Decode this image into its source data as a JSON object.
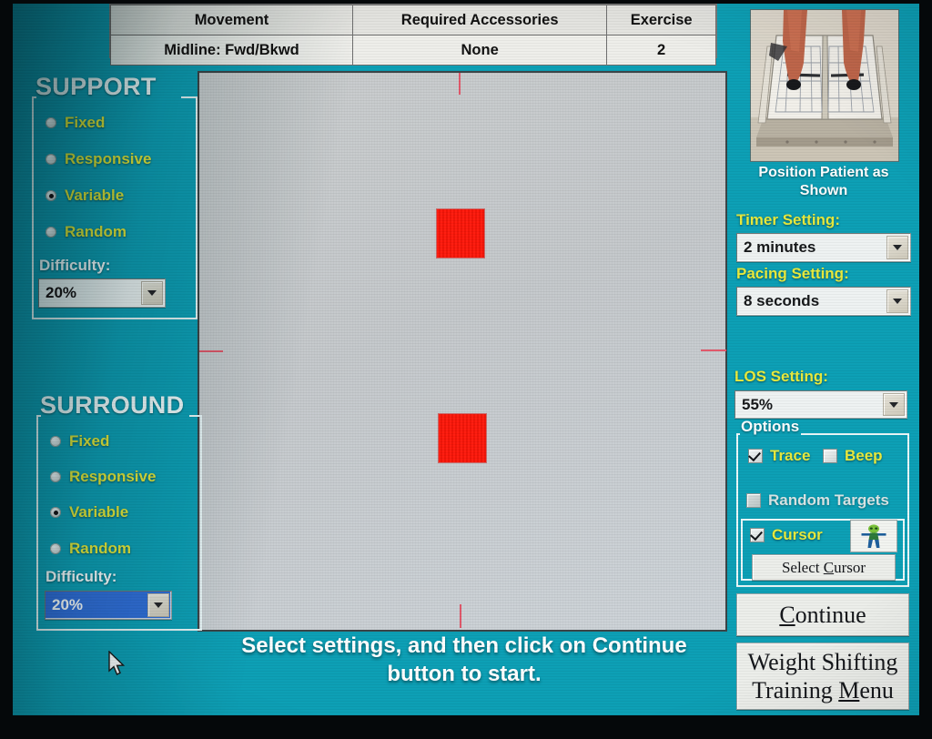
{
  "header": {
    "columns": [
      "Movement",
      "Required Accessories",
      "Exercise"
    ],
    "values": [
      "Midline: Fwd/Bkwd",
      "None",
      "2"
    ]
  },
  "support": {
    "title": "SUPPORT",
    "options": [
      {
        "label": "Fixed",
        "selected": false
      },
      {
        "label": "Responsive",
        "selected": false
      },
      {
        "label": "Variable",
        "selected": true
      },
      {
        "label": "Random",
        "selected": false
      }
    ],
    "difficulty_label": "Difficulty:",
    "difficulty_value": "20%"
  },
  "surround": {
    "title": "SURROUND",
    "options": [
      {
        "label": "Fixed",
        "selected": false
      },
      {
        "label": "Responsive",
        "selected": false
      },
      {
        "label": "Variable",
        "selected": true
      },
      {
        "label": "Random",
        "selected": false
      }
    ],
    "difficulty_label": "Difficulty:",
    "difficulty_value": "20%"
  },
  "instruction": {
    "line1": "Select settings, and then click on Continue",
    "line2": "button to start."
  },
  "right": {
    "photo_caption_line1": "Position Patient as",
    "photo_caption_line2": "Shown",
    "timer_label": "Timer Setting:",
    "timer_value": "2 minutes",
    "pacing_label": "Pacing Setting:",
    "pacing_value": "8 seconds",
    "los_label": "LOS Setting:",
    "los_value": "55%",
    "options_title": "Options",
    "trace_label": "Trace",
    "trace_checked": true,
    "beep_label": "Beep",
    "beep_checked": false,
    "random_targets_label": "Random Targets",
    "random_targets_checked": false,
    "cursor_label": "Cursor",
    "cursor_checked": true,
    "select_cursor_button": "Select Cursor",
    "select_cursor_accel": "C",
    "continue_button": "Continue",
    "continue_accel": "C",
    "menu_button_line1": "Weight Shifting",
    "menu_button_line2": "Training Menu",
    "menu_accel": "M"
  },
  "colors": {
    "background_teal": "#0c9fb5",
    "label_yellow": "#e8ea3d",
    "label_white": "#ffffff",
    "target_red": "#ff1d10",
    "canvas_gray": "#c9cccd",
    "selection_blue": "#2f6fd8"
  },
  "icons": {
    "cursor_figure": "person-figure-icon",
    "mouse_pointer": "mouse-pointer-icon",
    "dropdown": "chevron-down-icon"
  }
}
